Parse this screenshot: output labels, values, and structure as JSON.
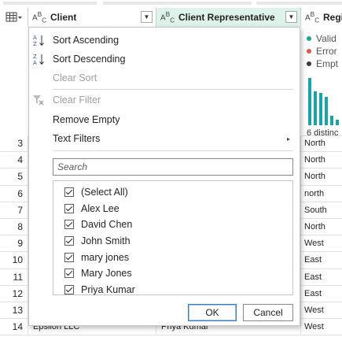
{
  "header": {
    "type_icon_text": "A",
    "type_icon_sup": "B",
    "type_icon_sub": "C",
    "columns": [
      {
        "title": "Client"
      },
      {
        "title": "Client Representative"
      },
      {
        "title": "Regi"
      }
    ],
    "dropdown_glyph": "▼"
  },
  "profile": {
    "quality": [
      {
        "label": "Valid",
        "color": "#1aa89b"
      },
      {
        "label": "Error",
        "color": "#e8544e"
      },
      {
        "label": "Empt",
        "color": "#3b3a39"
      }
    ],
    "distribution": [
      1.0,
      0.72,
      0.68,
      0.6,
      0.2,
      0.12
    ],
    "distinct_label": "6 distinc"
  },
  "rows": [
    {
      "num": "3",
      "client": "",
      "rep": "",
      "region": "North"
    },
    {
      "num": "4",
      "client": "",
      "rep": "",
      "region": "North"
    },
    {
      "num": "5",
      "client": "",
      "rep": "",
      "region": "North"
    },
    {
      "num": "6",
      "client": "",
      "rep": "",
      "region": "north"
    },
    {
      "num": "7",
      "client": "",
      "rep": "",
      "region": "South"
    },
    {
      "num": "8",
      "client": "",
      "rep": "",
      "region": "North"
    },
    {
      "num": "9",
      "client": "",
      "rep": "",
      "region": "West"
    },
    {
      "num": "10",
      "client": "",
      "rep": "",
      "region": "East"
    },
    {
      "num": "11",
      "client": "",
      "rep": "",
      "region": "East"
    },
    {
      "num": "12",
      "client": "",
      "rep": "",
      "region": "East"
    },
    {
      "num": "13",
      "client": "",
      "rep": "",
      "region": "West"
    },
    {
      "num": "14",
      "client": "Epsilon LLC",
      "rep": "Priya Kumar",
      "region": "West"
    }
  ],
  "menu": {
    "sort_ascending": "Sort Ascending",
    "sort_descending": "Sort Descending",
    "clear_sort": "Clear Sort",
    "clear_filter": "Clear Filter",
    "remove_empty": "Remove Empty",
    "text_filters": "Text Filters",
    "submenu_arrow": "▸",
    "search_placeholder": "Search",
    "items": [
      {
        "label": "(Select All)",
        "checked": true
      },
      {
        "label": "Alex Lee",
        "checked": true
      },
      {
        "label": "David Chen",
        "checked": true
      },
      {
        "label": "John Smith",
        "checked": true
      },
      {
        "label": "mary jones",
        "checked": true
      },
      {
        "label": "Mary Jones",
        "checked": true
      },
      {
        "label": "Priya Kumar",
        "checked": true
      }
    ],
    "ok_label": "OK",
    "cancel_label": "Cancel"
  }
}
